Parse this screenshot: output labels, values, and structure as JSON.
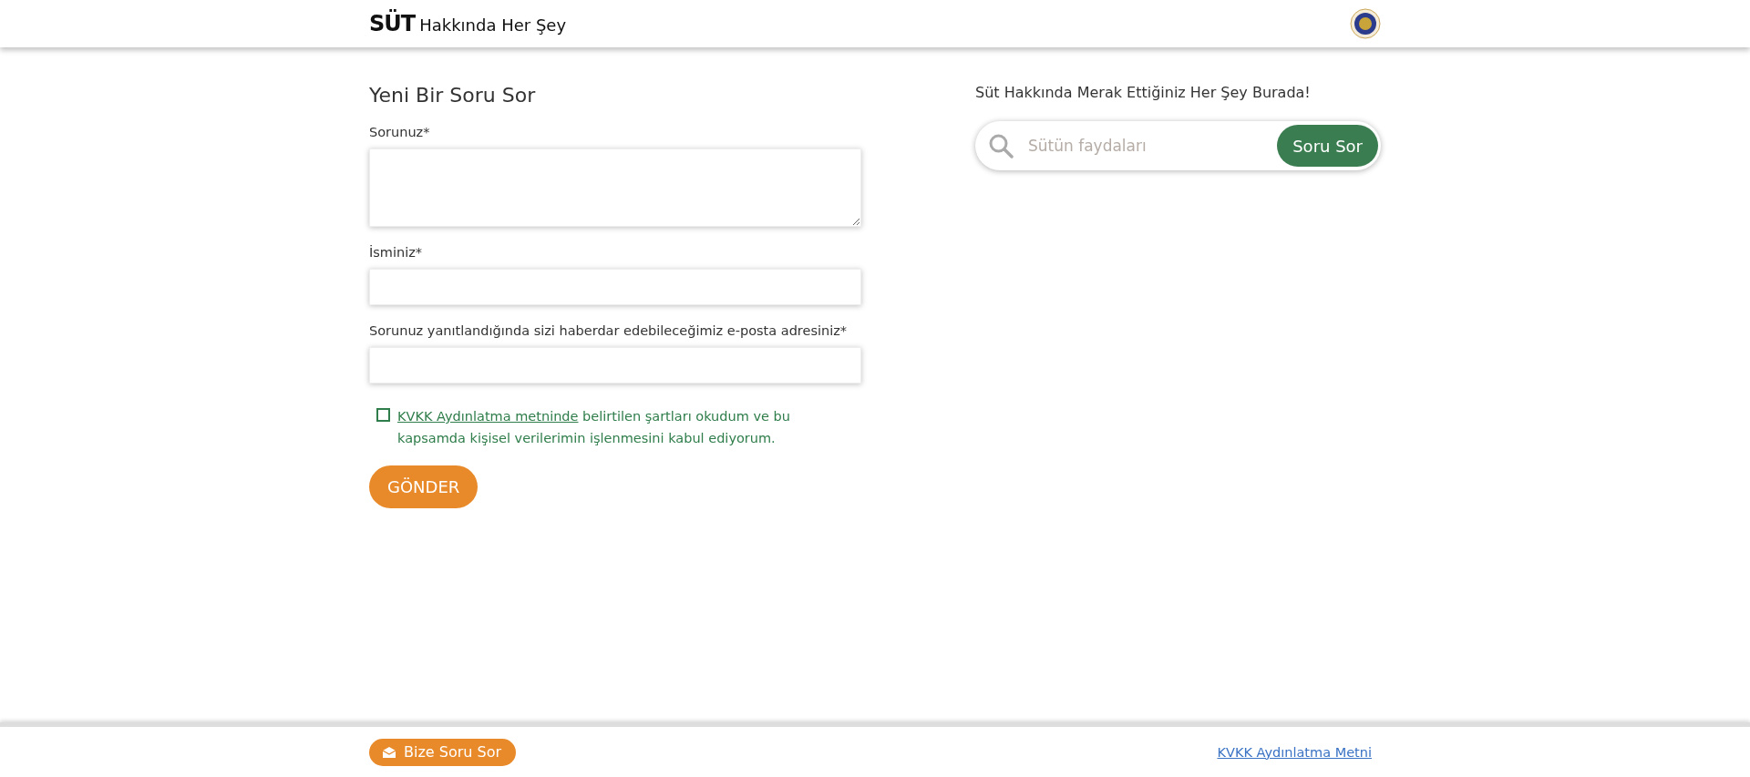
{
  "header": {
    "logo_mark": "SÜT",
    "logo_text": "Hakkında Her Şey"
  },
  "form": {
    "title": "Yeni Bir Soru Sor",
    "fields": [
      {
        "kind": "textarea",
        "label": "Sorunuz*"
      },
      {
        "kind": "input",
        "label": "İsminiz*"
      },
      {
        "kind": "input",
        "label": "Sorunuz yanıtlandığında sizi haberdar edebileceğimiz e-posta adresiniz*"
      }
    ],
    "consent": {
      "checked": false,
      "link": "KVKK Aydınlatma metninde",
      "text": "belirtilen şartları okudum ve bu kapsamda kişisel verilerimin işlenmesini kabul ediyorum."
    },
    "submit": "GÖNDER"
  },
  "search": {
    "heading": "Süt Hakkında Merak Ettiğiniz Her Şey Burada!",
    "placeholder": "Sütün faydaları",
    "button": "Soru Sor"
  },
  "footer": {
    "ask_button": "Bize Soru Sor",
    "link": "KVKK Aydınlatma Metni"
  }
}
